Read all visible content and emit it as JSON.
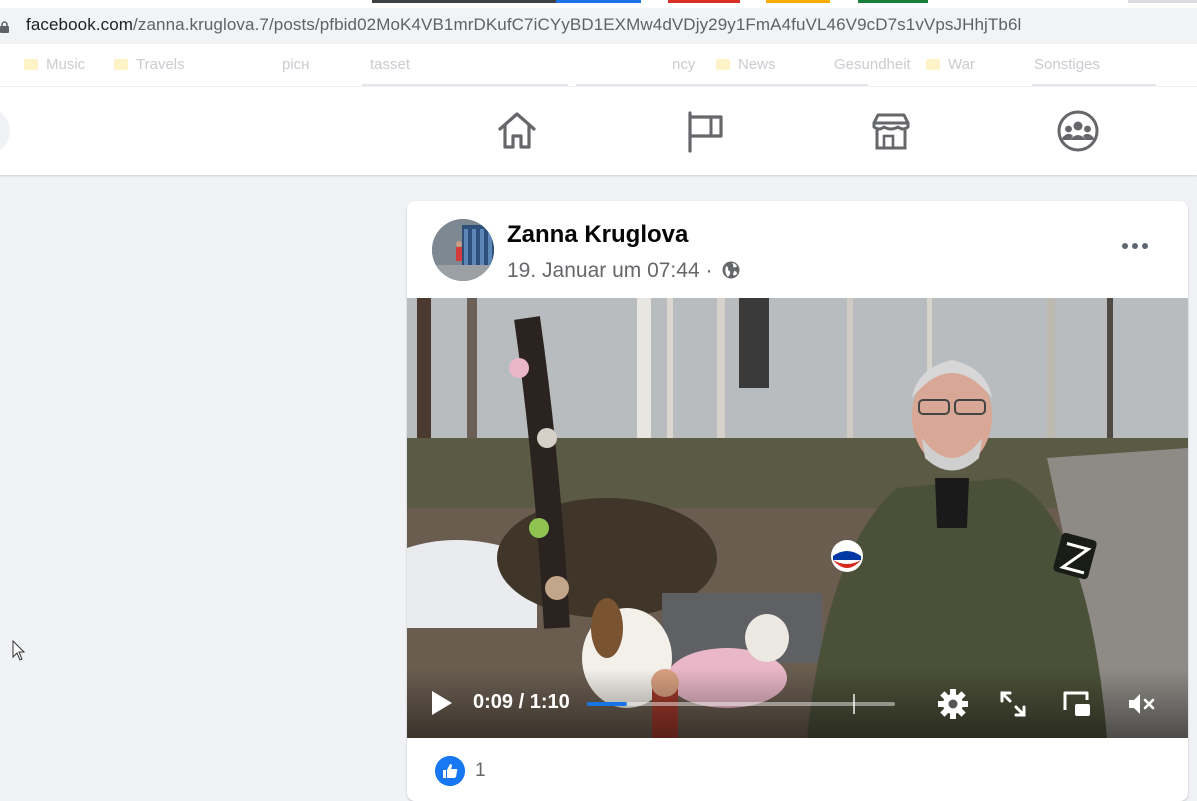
{
  "browser": {
    "url_host": "facebook.com",
    "url_path": "/zanna.kruglova.7/posts/pfbid02MoK4VB1mrDKufC7iCYyBD1EXMw4dVDjy29y1FmA4fuVL46V9cD7s1vVpsJHhjTb6l",
    "bookmarks": [
      "Music",
      "Travels",
      "рісн",
      "tasset",
      "ncy",
      "News",
      "Gesundheit",
      "War",
      "Sonstiges"
    ]
  },
  "nav": {
    "icons": [
      "home-icon",
      "pages-flag-icon",
      "marketplace-icon",
      "groups-icon"
    ]
  },
  "post": {
    "author": "Zanna Kruglova",
    "timestamp": "19. Januar um 07:44 ·",
    "audience_icon": "globe-icon",
    "video": {
      "time_display": "0:09 / 1:10",
      "progress": 0.13,
      "muted": true
    },
    "reactions": {
      "count": "1"
    }
  },
  "colors": {
    "facebook_blue": "#1877f2",
    "page_background": "#f0f2f5"
  }
}
